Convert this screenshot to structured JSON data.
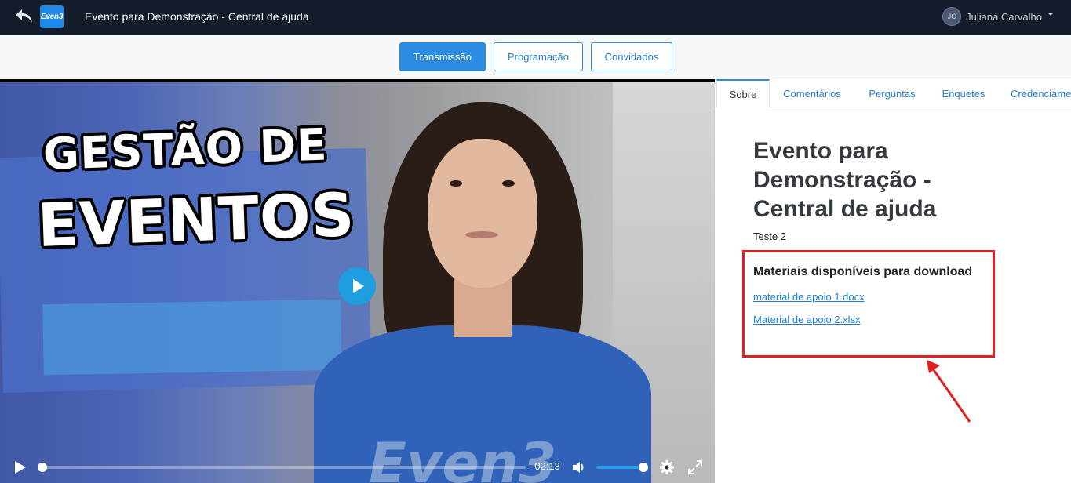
{
  "topbar": {
    "back_icon": "back-arrow-icon",
    "logo_text": "Even3",
    "title": "Evento para Demonstração - Central de ajuda",
    "user": {
      "initials": "JC",
      "name": "Juliana Carvalho"
    }
  },
  "nav": {
    "buttons": [
      {
        "label": "Transmissão",
        "active": true
      },
      {
        "label": "Programação",
        "active": false
      },
      {
        "label": "Convidados",
        "active": false
      }
    ]
  },
  "video": {
    "headline_line1": "GESTÃO DE",
    "headline_line2": "EVENTOS",
    "shirt_text": "Even3",
    "time_remaining": "-02:13",
    "progress": 0.0,
    "volume": 1.0
  },
  "side": {
    "tabs": [
      {
        "label": "Sobre",
        "active": true
      },
      {
        "label": "Comentários",
        "active": false
      },
      {
        "label": "Perguntas",
        "active": false
      },
      {
        "label": "Enquetes",
        "active": false
      },
      {
        "label": "Credenciame",
        "active": false
      }
    ],
    "event_title": "Evento para Demonstração - Central de ajuda",
    "event_subtitle": "Teste 2",
    "materials": {
      "title": "Materiais disponíveis para download",
      "files": [
        "material de apoio 1.docx",
        "Material de apoio 2.xlsx"
      ]
    }
  },
  "colors": {
    "accent": "#2b8be0",
    "topbar": "#151c2b",
    "highlight": "#e02020"
  }
}
